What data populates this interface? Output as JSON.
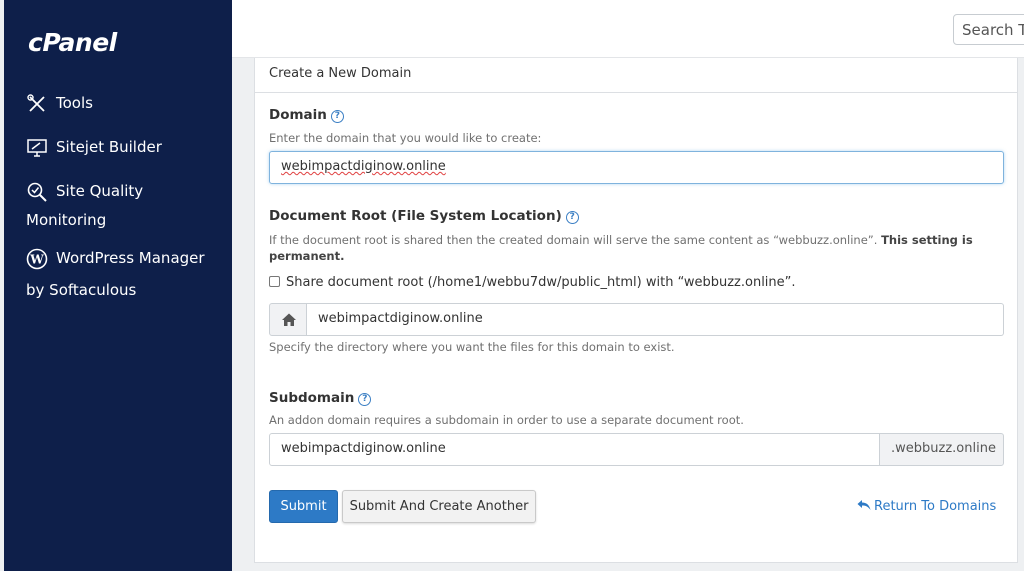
{
  "app": {
    "logo_text": "cPanel"
  },
  "sidebar": {
    "items": [
      {
        "label": "Tools",
        "icon": "tools-icon"
      },
      {
        "label": "Sitejet Builder",
        "icon": "monitor-icon"
      },
      {
        "label": "Site Quality",
        "label2": "Monitoring",
        "icon": "magnifier-check-icon"
      },
      {
        "label": "WordPress Manager",
        "label2": "by Softaculous",
        "icon": "wordpress-icon"
      }
    ]
  },
  "header": {
    "search_placeholder": "Search To"
  },
  "form": {
    "title": "Create a New Domain",
    "domain": {
      "label": "Domain",
      "hint": "Enter the domain that you would like to create:",
      "value": "webimpactdiginow.online"
    },
    "docroot": {
      "label": "Document Root (File System Location)",
      "hint_prefix": "If the document root is shared then the created domain will serve the same content as “webbuzz.online”.",
      "hint_bold_1": "This setting is",
      "hint_bold_2": "permanent.",
      "share_label": "Share document root (/home1/webbu7dw/public_html) with “webbuzz.online”.",
      "share_checked": false,
      "value": "webimpactdiginow.online",
      "help": "Specify the directory where you want the files for this domain to exist."
    },
    "subdomain": {
      "label": "Subdomain",
      "hint": "An addon domain requires a subdomain in order to use a separate document root.",
      "value": "webimpactdiginow.online",
      "suffix": ".webbuzz.online"
    },
    "buttons": {
      "submit": "Submit",
      "submit_another": "Submit And Create Another",
      "return": "Return To Domains"
    }
  },
  "colors": {
    "sidebar_bg": "#0e1f4a",
    "primary": "#2d7ac6"
  }
}
